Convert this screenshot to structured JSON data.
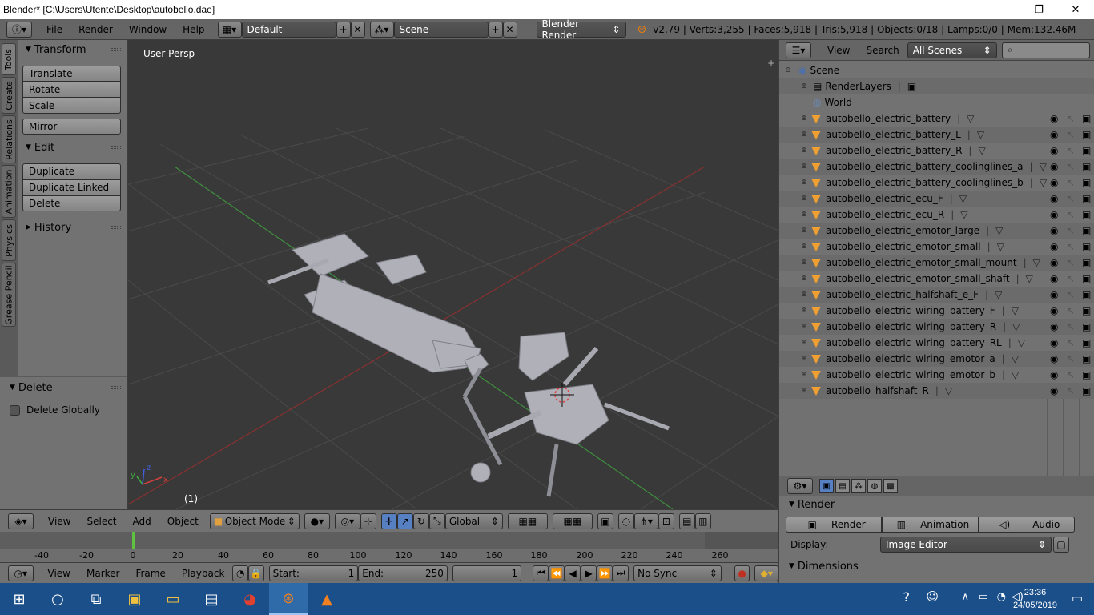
{
  "window": {
    "title": "Blender* [C:\\Users\\Utente\\Desktop\\autobello.dae]",
    "minimize": "—",
    "maximize": "❐",
    "close": "✕"
  },
  "info_header": {
    "menus": [
      "File",
      "Render",
      "Window",
      "Help"
    ],
    "screen_layout": "Default",
    "scene": "Scene",
    "engine": "Blender Render",
    "stats": "v2.79 | Verts:3,255 | Faces:5,918 | Tris:5,918 | Objects:0/18 | Lamps:0/0 | Mem:132.46M"
  },
  "tool_tabs": [
    "Tools",
    "Create",
    "Relations",
    "Animation",
    "Physics",
    "Grease Pencil"
  ],
  "tools": {
    "transform_header": "Transform",
    "translate": "Translate",
    "rotate": "Rotate",
    "scale": "Scale",
    "mirror": "Mirror",
    "edit_header": "Edit",
    "duplicate": "Duplicate",
    "duplicate_linked": "Duplicate Linked",
    "delete": "Delete",
    "history_header": "History"
  },
  "operator_panel": {
    "header": "Delete",
    "delete_globally": "Delete Globally"
  },
  "viewport": {
    "label": "User Persp",
    "frame_label": "(1)",
    "axis_x": "x",
    "axis_y": "y",
    "axis_z": "z"
  },
  "viewport_header": {
    "menus": [
      "View",
      "Select",
      "Add",
      "Object"
    ],
    "mode": "Object Mode",
    "orientation": "Global"
  },
  "timeline": {
    "ticks": [
      "-40",
      "-20",
      "0",
      "20",
      "40",
      "60",
      "80",
      "100",
      "120",
      "140",
      "160",
      "180",
      "200",
      "220",
      "240",
      "260"
    ],
    "menus": [
      "View",
      "Marker",
      "Frame",
      "Playback"
    ],
    "start_label": "Start:",
    "start_value": "1",
    "end_label": "End:",
    "end_value": "250",
    "current_frame": "1",
    "sync": "No Sync"
  },
  "outliner": {
    "view": "View",
    "search": "Search",
    "filter": "All Scenes",
    "scene": "Scene",
    "render_layers": "RenderLayers",
    "world": "World",
    "objects": [
      "autobello_electric_battery",
      "autobello_electric_battery_L",
      "autobello_electric_battery_R",
      "autobello_electric_battery_coolinglines_a",
      "autobello_electric_battery_coolinglines_b",
      "autobello_electric_ecu_F",
      "autobello_electric_ecu_R",
      "autobello_electric_emotor_large",
      "autobello_electric_emotor_small",
      "autobello_electric_emotor_small_mount",
      "autobello_electric_emotor_small_shaft",
      "autobello_electric_halfshaft_e_F",
      "autobello_electric_wiring_battery_F",
      "autobello_electric_wiring_battery_R",
      "autobello_electric_wiring_battery_RL",
      "autobello_electric_wiring_emotor_a",
      "autobello_electric_wiring_emotor_b",
      "autobello_halfshaft_R"
    ]
  },
  "properties": {
    "render_header": "Render",
    "render_btn": "Render",
    "animation_btn": "Animation",
    "audio_btn": "Audio",
    "display_label": "Display:",
    "display_value": "Image Editor",
    "dimensions_header": "Dimensions"
  },
  "taskbar": {
    "time": "23:36",
    "date": "24/05/2019"
  },
  "colors": {
    "mesh_icon": "#f0a030",
    "viewport_bg": "#393939",
    "x_axis": "#a03030",
    "y_axis": "#3f8f3f",
    "active_frame": "#60c040",
    "taskbar": "#1b4f8a"
  }
}
